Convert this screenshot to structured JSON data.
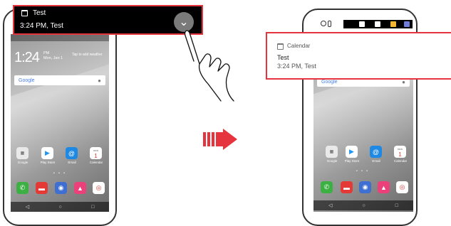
{
  "notification_collapsed": {
    "title": "Test",
    "subtitle": "3:24 PM, Test",
    "app_icon": "calendar-icon",
    "expand_icon": "chevron-down-icon"
  },
  "notification_expanded": {
    "app_name": "Calendar",
    "title": "Test",
    "subtitle": "3:24 PM, Test",
    "app_icon": "calendar-icon"
  },
  "left_phone": {
    "clock": "1:24",
    "clock_ampm": "PM",
    "clock_date": "Mon, Jan 1",
    "weather_hint": "Tap to add weather",
    "search_brand": "Google",
    "apps": [
      {
        "label": "Google",
        "icon": "google-folder-icon",
        "color": "#e9e9e9"
      },
      {
        "label": "Play Store",
        "icon": "play-store-icon",
        "color": "#ffffff"
      },
      {
        "label": "Email",
        "icon": "email-icon",
        "color": "#1e88e5"
      },
      {
        "label": "Calendar",
        "icon": "calendar-icon",
        "color": "#ffffff"
      }
    ],
    "calendar_icon_text": "MON",
    "calendar_icon_day": "1",
    "dock": [
      {
        "icon": "phone-icon",
        "color": "#3cb043"
      },
      {
        "icon": "messages-icon",
        "color": "#e53935"
      },
      {
        "icon": "camera-icon",
        "color": "#3f6fd1"
      },
      {
        "icon": "gallery-icon",
        "color": "#ec407a"
      },
      {
        "icon": "chrome-icon",
        "color": "#ffffff"
      }
    ],
    "nav": [
      "◁",
      "○",
      "□"
    ]
  },
  "right_phone": {
    "search_brand": "Google",
    "apps": [
      {
        "label": "Google",
        "icon": "google-folder-icon",
        "color": "#e9e9e9"
      },
      {
        "label": "Play Store",
        "icon": "play-store-icon",
        "color": "#ffffff"
      },
      {
        "label": "Email",
        "icon": "email-icon",
        "color": "#1e88e5"
      },
      {
        "label": "Calendar",
        "icon": "calendar-icon",
        "color": "#ffffff"
      }
    ],
    "calendar_icon_text": "MON",
    "calendar_icon_day": "1",
    "nav": [
      "◁",
      "○",
      "□"
    ]
  },
  "colors": {
    "highlight": "#e6343f",
    "arrow": "#e6343f"
  }
}
